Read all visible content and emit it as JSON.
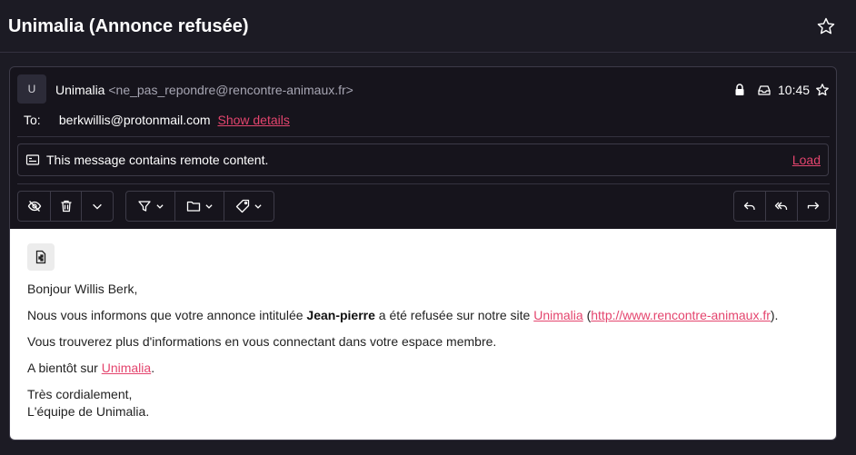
{
  "subject": {
    "title": "Unimalia (Annonce refusée)"
  },
  "header": {
    "avatar_letter": "U",
    "sender_name": "Unimalia",
    "sender_address": "<ne_pas_repondre@rencontre-animaux.fr>",
    "time": "10:45",
    "to_label": "To:",
    "to_address": "berkwillis@protonmail.com",
    "show_details": "Show details"
  },
  "remote_banner": {
    "text": "This message contains remote content.",
    "load": "Load"
  },
  "toolbar": {
    "left": [
      "eye-slash-icon",
      "trash-icon",
      "chevron-down-icon"
    ],
    "middle": [
      "filter-icon",
      "folder-icon",
      "tag-icon"
    ],
    "right": [
      "reply-icon",
      "reply-all-icon",
      "forward-icon"
    ]
  },
  "body": {
    "greeting": "Bonjour Willis Berk,",
    "line1_pre": "Nous vous informons que votre annonce intitulée ",
    "line1_bold": "Jean-pierre",
    "line1_mid": " a été refusée sur notre site ",
    "line1_link1": "Unimalia",
    "line1_paren_open": " (",
    "line1_link2": "http://www.rencontre-animaux.fr",
    "line1_end": ").",
    "line2": "Vous trouverez plus d'informations en vous connectant dans votre espace membre.",
    "line3_pre": "A bientôt sur ",
    "line3_link": "Unimalia",
    "line3_end": ".",
    "sign1": "Très cordialement,",
    "sign2": "L'équipe de Unimalia."
  },
  "colors": {
    "background": "#1c1b24",
    "accent_link": "#e4456e",
    "border": "#3d3b48"
  }
}
